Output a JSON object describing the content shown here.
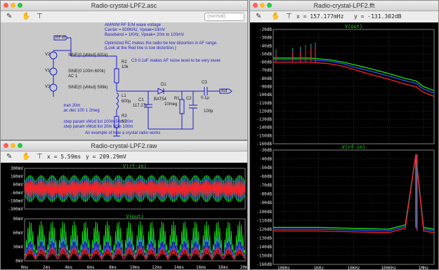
{
  "colors": {
    "green": "#19e619",
    "blue": "#2855ff",
    "red": "#ff2020",
    "grid": "#555555",
    "schematic_blue": "#1d1dc8"
  },
  "schematic_window": {
    "title": "Radio-crystal-LPF2.asc",
    "search_placeholder": "(normal)",
    "icons": [
      "cursor-icon",
      "hand-icon",
      "probe-icon"
    ],
    "notes": [
      "AM/WM RF E/M wave voltage",
      "Carrier = 600KHz, Vpeak=10mV",
      "Baseband = 1KHz, Vpeak= 20m to 100mV",
      "Optimized RC makes the radio be low distortion in AF range.",
      "(Look at the Red line is low distortion.)",
      "C3 0.1uF makes AF noise level to be very lower.",
      "An example of how a crystal radio works"
    ],
    "labels": {
      "rf_in": "RF-in",
      "out": "out",
      "v2": "V2",
      "v1": "V1",
      "v3": "V3",
      "ac1": "AC 1",
      "v2_val": "SINE(0 {vMod} 601k)",
      "v1_val": "SINE(0 100m 600k)",
      "v3_val": "SINE(0 {vMod} 599k)",
      "r2": "R2",
      "r2_val": "10k",
      "l1": "L1",
      "l1_val": "600µ",
      "r3": "R3",
      "r3_val": "60",
      "c1": "C1",
      "c1_val": "117.27p",
      "d1": "D1",
      "d1_val": "BAT54",
      "r1": "R1",
      "r1_val": "10meg",
      "c2": "C2",
      "c2_val": "100p",
      "c3": "C3",
      "c3_val": "0.1µ"
    },
    "directives": [
      ".tran 20m",
      ".ac dec 100 1 2meg",
      ".step param vMod list 100m 50m 20m",
      ".step param vMod list 20m 50m 100m"
    ]
  },
  "fft_window": {
    "title": "Radio-crystal-LPF2.fft",
    "readout_x": "x = 157.177mHz",
    "readout_y": "y = -131.302dB",
    "top_plot_title": "V(out)",
    "bottom_plot_title": "V(rf-in)",
    "top_yticks": [
      "-20dB",
      "-30dB",
      "-40dB",
      "-50dB",
      "-60dB",
      "-70dB",
      "-80dB",
      "-90dB",
      "-100dB",
      "-110dB",
      "-120dB",
      "-130dB",
      "-140dB",
      "-150dB",
      "-160dB"
    ],
    "bottom_yticks": [
      "-30dB",
      "-40dB",
      "-50dB",
      "-60dB",
      "-70dB",
      "-80dB",
      "-90dB",
      "-100dB",
      "-110dB",
      "-120dB",
      "-130dB",
      "-140dB",
      "-150dB",
      "-160dB"
    ],
    "xticks": [
      "100Hz",
      "1KHz",
      "10KHz",
      "100KHz",
      "1MHz"
    ]
  },
  "raw_window": {
    "title": "Radio-crystal-LPF2.raw",
    "readout_x": "x = 5.59ms",
    "readout_y": "y = 209.29mV",
    "top_plot_title": "V(rf-in)",
    "bottom_plot_title": "V(out)",
    "top_yticks": [
      "300mV",
      "180mV",
      "60mV",
      "-60mV",
      "-180mV",
      "-300mV"
    ],
    "bottom_yticks": [
      "90mV",
      "60mV",
      "30mV",
      "0mV"
    ],
    "xticks": [
      "0ms",
      "2ms",
      "4ms",
      "6ms",
      "8ms",
      "10ms",
      "12ms",
      "14ms",
      "16ms",
      "18ms",
      "20ms"
    ]
  },
  "chart_data": [
    {
      "type": "line",
      "title": "V(out)",
      "xlabel": "",
      "ylabel": "",
      "xscale": "log",
      "xlim": [
        50,
        2000000
      ],
      "ylim": [
        -160,
        -20
      ],
      "grid": true,
      "series": [
        {
          "x": [
            50,
            300,
            600,
            1000,
            2000,
            5000,
            10000,
            30000,
            100000,
            300000,
            600000,
            1000000,
            2000000
          ],
          "values": [
            -55,
            -55,
            -55,
            -56,
            -57,
            -60,
            -63,
            -68,
            -74,
            -80,
            -83,
            -90,
            -95
          ]
        },
        {
          "x": [
            50,
            300,
            600,
            1000,
            2000,
            5000,
            10000,
            30000,
            100000,
            300000,
            600000,
            1000000,
            2000000
          ],
          "values": [
            -57,
            -57,
            -57,
            -58,
            -59,
            -62,
            -66,
            -71,
            -77,
            -83,
            -86,
            -93,
            -98
          ]
        },
        {
          "x": [
            50,
            300,
            600,
            1000,
            2000,
            5000,
            10000,
            30000,
            100000,
            300000,
            600000,
            1000000,
            2000000
          ],
          "values": [
            -60,
            -60,
            -60,
            -61,
            -62,
            -65,
            -69,
            -75,
            -81,
            -87,
            -90,
            -97,
            -102
          ]
        }
      ]
    },
    {
      "type": "line",
      "title": "V(rf-in)",
      "xlabel": "",
      "ylabel": "",
      "xscale": "log",
      "xlim": [
        50,
        2000000
      ],
      "ylim": [
        -160,
        -30
      ],
      "grid": true,
      "series": [
        {
          "x": [
            50,
            1000,
            10000,
            100000,
            300000,
            600000,
            1000000,
            2000000
          ],
          "values": [
            -118,
            -118,
            -119,
            -120,
            -115,
            -35,
            -118,
            -120
          ]
        },
        {
          "x": [
            50,
            1000,
            10000,
            100000,
            300000,
            600000,
            1000000,
            2000000
          ],
          "values": [
            -120,
            -120,
            -121,
            -122,
            -117,
            -35,
            -120,
            -122
          ]
        },
        {
          "x": [
            50,
            1000,
            10000,
            100000,
            300000,
            600000,
            1000000,
            2000000
          ],
          "values": [
            -122,
            -122,
            -123,
            -124,
            -119,
            -35,
            -122,
            -124
          ]
        }
      ]
    },
    {
      "type": "line",
      "title": "V(rf-in)",
      "xlabel": "",
      "ylabel": "",
      "xlim": [
        0,
        20
      ],
      "ylim": [
        -300,
        300
      ],
      "grid": true,
      "series": [
        {
          "description_free": true,
          "x": [
            0,
            5,
            10,
            15,
            20
          ],
          "values": [
            200,
            200,
            200,
            200,
            200
          ]
        },
        {
          "x": [
            0,
            5,
            10,
            15,
            20
          ],
          "values": [
            160,
            160,
            160,
            160,
            160
          ]
        },
        {
          "x": [
            0,
            5,
            10,
            15,
            20
          ],
          "values": [
            120,
            120,
            120,
            120,
            120
          ]
        }
      ]
    },
    {
      "type": "line",
      "title": "V(out)",
      "xlabel": "",
      "ylabel": "",
      "xlim": [
        0,
        20
      ],
      "ylim": [
        0,
        90
      ],
      "grid": true,
      "series": [
        {
          "x": [
            0,
            5,
            10,
            15,
            20
          ],
          "values": [
            85,
            85,
            85,
            85,
            85
          ]
        },
        {
          "x": [
            0,
            5,
            10,
            15,
            20
          ],
          "values": [
            50,
            50,
            50,
            50,
            50
          ]
        },
        {
          "x": [
            0,
            5,
            10,
            15,
            20
          ],
          "values": [
            30,
            30,
            30,
            30,
            30
          ]
        }
      ]
    }
  ]
}
